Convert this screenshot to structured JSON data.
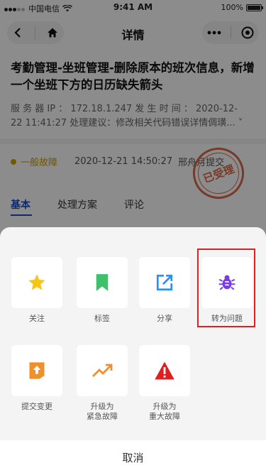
{
  "status_bar": {
    "carrier": "中国电信",
    "time": "9:41 AM",
    "battery": "100%"
  },
  "nav": {
    "title": "详情"
  },
  "detail": {
    "title": "考勤管理-坐班管理-删除原本的班次信息，新增一个坐班下方的日历缺失箭头",
    "info_line1": "服 务 器 IP ： 172.18.1.247  发 生 时 间 ： 2020-12-",
    "info_line2": "22 11:41:27 处理建议：修改相关代码错误详情倜璜...",
    "level": "一般故障",
    "datetime": "2020-12-21 14:50:27",
    "submitter": "邢舟月提交",
    "stamp": "已受理"
  },
  "tabs": [
    {
      "label": "基本"
    },
    {
      "label": "处理方案"
    },
    {
      "label": "评论"
    }
  ],
  "actions": [
    {
      "label": "关注",
      "icon": "star-icon"
    },
    {
      "label": "标签",
      "icon": "bookmark-icon"
    },
    {
      "label": "分享",
      "icon": "share-icon"
    },
    {
      "label": "转为问题",
      "icon": "bug-icon"
    },
    {
      "label": "提交变更",
      "icon": "upload-icon"
    },
    {
      "label": "升级为\n紧急故障",
      "icon": "trend-up-icon"
    },
    {
      "label": "升级为\n重大故障",
      "icon": "warning-icon"
    }
  ],
  "cancel_label": "取消",
  "colors": {
    "accent": "#1a4dbf",
    "star": "#f5c518",
    "bookmark": "#3fc06a",
    "share": "#2f8ff0",
    "bug": "#7a3ce0",
    "upload": "#f0902a",
    "trend": "#f0902a",
    "warning": "#e02020"
  }
}
